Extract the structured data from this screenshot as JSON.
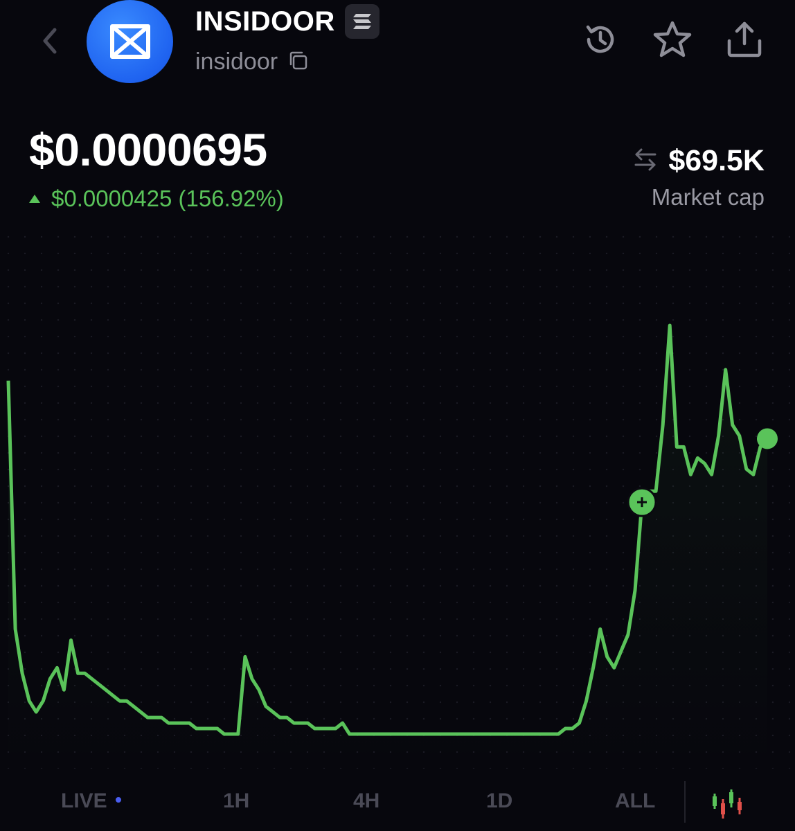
{
  "header": {
    "token_name": "INSIDOOR",
    "ticker": "insidoor",
    "icons": {
      "back": "chevron-left-icon",
      "logo": "token-logo-icon",
      "chain": "solana-icon",
      "copy": "copy-icon",
      "history": "history-icon",
      "favorite": "star-icon",
      "share": "share-icon"
    }
  },
  "price": {
    "current": "$0.0000695",
    "change_text": "$0.0000425 (156.92%)",
    "direction": "up",
    "color_up": "#5ac35a"
  },
  "market_cap": {
    "value": "$69.5K",
    "label": "Market cap",
    "icon": "swap-arrows-icon"
  },
  "chart_data": {
    "type": "line",
    "color": "#5ac35a",
    "grid": "dotted",
    "y_scale": "linear",
    "series": [
      {
        "name": "",
        "values": [
          8e-05,
          3.5e-05,
          2.7e-05,
          2.2e-05,
          2e-05,
          2.2e-05,
          2.6e-05,
          2.8e-05,
          2.4e-05,
          3.3e-05,
          2.7e-05,
          2.7e-05,
          2.6e-05,
          2.5e-05,
          2.4e-05,
          2.3e-05,
          2.2e-05,
          2.2e-05,
          2.1e-05,
          2e-05,
          1.9e-05,
          1.9e-05,
          1.9e-05,
          1.8e-05,
          1.8e-05,
          1.8e-05,
          1.8e-05,
          1.7e-05,
          1.7e-05,
          1.7e-05,
          1.7e-05,
          1.6e-05,
          1.6e-05,
          1.6e-05,
          3e-05,
          2.6e-05,
          2.4e-05,
          2.1e-05,
          2e-05,
          1.9e-05,
          1.9e-05,
          1.8e-05,
          1.8e-05,
          1.8e-05,
          1.7e-05,
          1.7e-05,
          1.7e-05,
          1.7e-05,
          1.8e-05,
          1.6e-05,
          1.6e-05,
          1.6e-05,
          1.6e-05,
          1.6e-05,
          1.6e-05,
          1.6e-05,
          1.6e-05,
          1.6e-05,
          1.6e-05,
          1.6e-05,
          1.6e-05,
          1.6e-05,
          1.6e-05,
          1.6e-05,
          1.6e-05,
          1.6e-05,
          1.6e-05,
          1.6e-05,
          1.6e-05,
          1.6e-05,
          1.6e-05,
          1.6e-05,
          1.6e-05,
          1.6e-05,
          1.6e-05,
          1.6e-05,
          1.6e-05,
          1.6e-05,
          1.6e-05,
          1.6e-05,
          1.7e-05,
          1.7e-05,
          1.8e-05,
          2.2e-05,
          2.8e-05,
          3.5e-05,
          3e-05,
          2.8e-05,
          3.1e-05,
          3.4e-05,
          4.2e-05,
          5.8e-05,
          6e-05,
          6e-05,
          7.2e-05,
          9e-05,
          6.8e-05,
          6.8e-05,
          6.3e-05,
          6.6e-05,
          6.5e-05,
          6.3e-05,
          7e-05,
          8.2e-05,
          7.2e-05,
          7e-05,
          6.4e-05,
          6.3e-05,
          6.8e-05,
          6.95e-05
        ]
      }
    ]
  },
  "time_ranges": {
    "live": "LIVE",
    "h1": "1H",
    "h4": "4H",
    "d1": "1D",
    "all": "ALL"
  },
  "chart_toggle_icon": "candlestick-icon"
}
